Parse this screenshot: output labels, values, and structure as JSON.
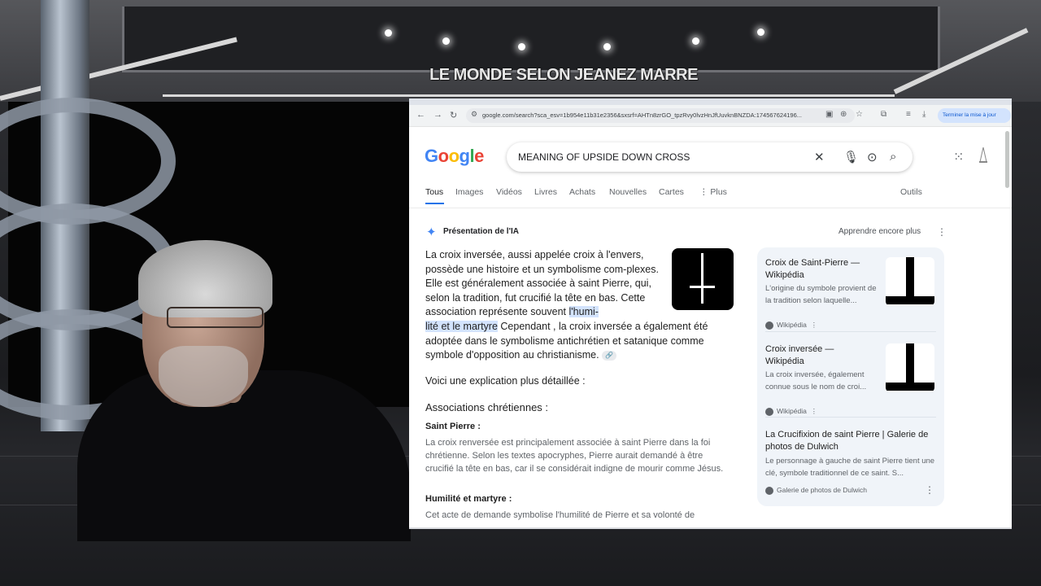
{
  "overlay": {
    "show_title": "LE MONDE SELON JEANEZ MARRE"
  },
  "browser": {
    "url": "google.com/search?sca_esv=1b954e11b31e2356&sxsrf=AHTn8zrGO_tpzRvy0lvzHnJfUuvknBNZDA:174567624196...",
    "update_button": "Terminer la mise à jour"
  },
  "search": {
    "query": "MEANING OF UPSIDE DOWN CROSS",
    "logo": [
      "G",
      "o",
      "o",
      "g",
      "l",
      "e"
    ],
    "logo_colors": [
      "#4285F4",
      "#EA4335",
      "#FBBC05",
      "#4285F4",
      "#34A853",
      "#EA4335"
    ]
  },
  "tabs": [
    "Tous",
    "Images",
    "Vidéos",
    "Livres",
    "Achats",
    "Nouvelles",
    "Cartes",
    "⋮ Plus"
  ],
  "tools_label": "Outils",
  "ai_overview": {
    "title": "Présentation de l'IA",
    "learn_more": "Apprendre encore plus",
    "p1_part1": "La croix inversée, aussi appelée croix à l'envers, possède une histoire et un symbolisme com-plexes. Elle est généralement associée à saint Pierre, qui, selon la tradition, fut crucifié la tête en bas. Cette association représente souvent ",
    "p1_highlight1": "l'humi-",
    "p1_highlight2": "lité et le martyre",
    "p1_part2": " Cependant , la croix inversée a également été adoptée dans le symbolisme antichrétien et satanique comme symbole d'opposition au christianisme.",
    "explain": "Voici une explication plus détaillée :",
    "section_heading": "Associations chrétiennes :",
    "sub1_heading": "Saint Pierre :",
    "sub1_text": "La croix renversée est principalement associée à saint Pierre dans la foi chrétienne. Selon les textes apocryphes, Pierre aurait demandé à être crucifié la tête en bas, car il se considérait indigne de mourir comme Jésus.",
    "sub2_heading": "Humilité et martyre :",
    "sub2_text": "Cet acte de demande symbolise l'humilité de Pierre et sa volonté de"
  },
  "sources": [
    {
      "title": "Croix de Saint-Pierre — Wikipédia",
      "desc": "L'origine du symbole provient de la tradition selon laquelle...",
      "site": "Wikipédia"
    },
    {
      "title": "Croix inversée — Wikipédia",
      "desc": "La croix inversée, également connue sous le nom de croi...",
      "site": "Wikipédia"
    },
    {
      "title": "La Crucifixion de saint Pierre | Galerie de photos de Dulwich",
      "desc": "Le personnage à gauche de saint Pierre tient une clé, symbole traditionnel de ce saint. S...",
      "site": "Galerie de photos de Dulwich"
    }
  ]
}
